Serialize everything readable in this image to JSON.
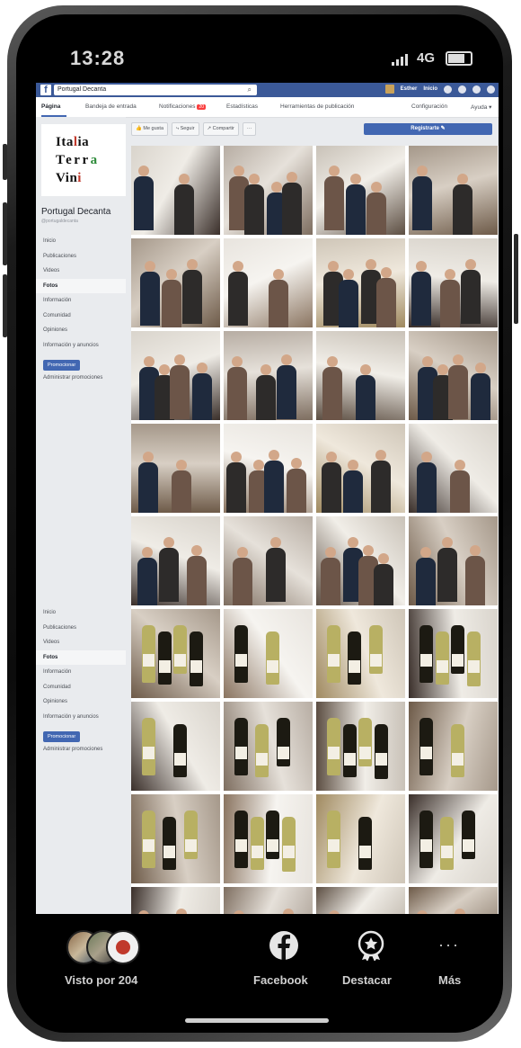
{
  "status": {
    "time": "13:28",
    "network": "4G"
  },
  "fb": {
    "search_value": "Portugal Decanta",
    "top_right": {
      "profile_name": "Esther",
      "home": "Inicio"
    },
    "tabs": [
      {
        "label": "Página"
      },
      {
        "label": "Bandeja de entrada"
      },
      {
        "label": "Notificaciones",
        "badge": "20"
      },
      {
        "label": "Estadísticas"
      },
      {
        "label": "Herramientas de publicación"
      },
      {
        "label": "Configuración"
      },
      {
        "label": "Ayuda ▾"
      }
    ],
    "actions": {
      "like": "Me gusta",
      "follow": "Seguir",
      "share": "Compartir",
      "more": "···",
      "register": "Registrarte"
    },
    "logo_lines": [
      "Italia",
      "Terra",
      "Vini"
    ],
    "page_name": "Portugal Decanta",
    "page_handle": "@portugaldecanta",
    "nav_items": [
      "Inicio",
      "Publicaciones",
      "Videos",
      "Fotos",
      "Información",
      "Comunidad",
      "Opiniones",
      "Información y anuncios"
    ],
    "nav_selected": "Fotos",
    "promote_label": "Promocionar",
    "admin_label": "Administrar promociones"
  },
  "bottom": {
    "seen_by": "Visto por 204",
    "facebook": "Facebook",
    "highlight": "Destacar",
    "more": "Más"
  },
  "colors": {
    "fb_blue": "#3b5998",
    "button_blue": "#4267b2",
    "page_bg": "#e9ebee"
  }
}
